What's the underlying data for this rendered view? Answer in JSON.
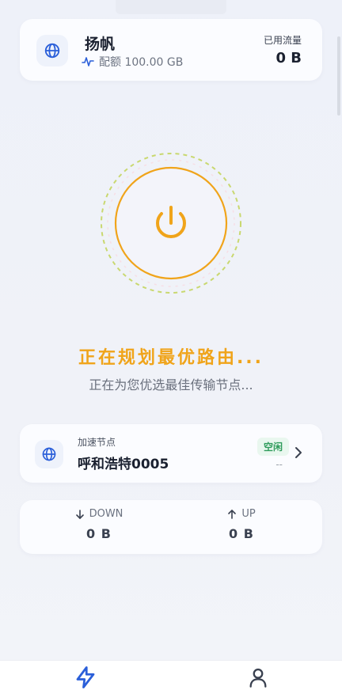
{
  "header": {
    "plan_name": "扬帆",
    "quota_text": "配额 100.00 GB",
    "used_label": "已用流量",
    "used_value": "0 B"
  },
  "status": {
    "title": "正在规划最优路由...",
    "subtitle": "正在为您优选最佳传输节点..."
  },
  "node": {
    "label": "加速节点",
    "name": "呼和浩特0005",
    "status_badge": "空闲",
    "latency": "--"
  },
  "traffic": {
    "down_label": "DOWN",
    "down_value": "0 B",
    "up_label": "UP",
    "up_value": "0 B"
  },
  "tabs": [
    {
      "icon": "lightning-icon",
      "active": true
    },
    {
      "icon": "user-icon",
      "active": false
    }
  ],
  "colors": {
    "accent": "#f0a41a",
    "ring_outer_dash": "#bcd46a",
    "primary_blue": "#2b5fd9",
    "idle_green": "#2e9b5b"
  }
}
